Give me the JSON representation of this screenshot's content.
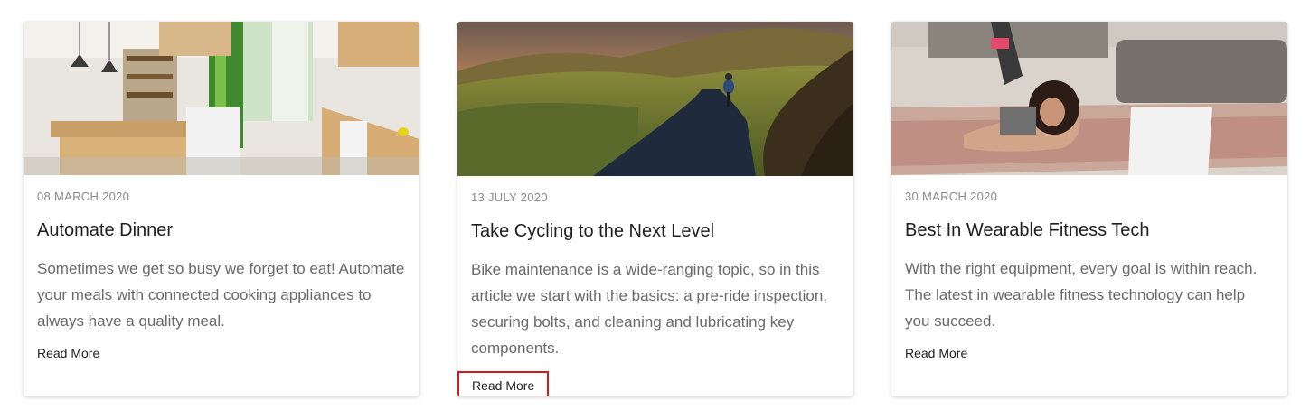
{
  "highlight_color": "#d41b1b",
  "cards": [
    {
      "image_desc": "modern-kitchen-image",
      "date": "08 MARCH 2020",
      "title": "Automate Dinner",
      "excerpt": "Sometimes we get so busy we forget to eat! Automate your meals with connected cooking appliances to always have a quality meal.",
      "read_more": "Read More"
    },
    {
      "image_desc": "cyclist-on-mountain-road-image",
      "date": "13 JULY 2020",
      "title": "Take Cycling to the Next Level",
      "excerpt": "Bike maintenance is a wide-ranging topic, so in this article we start with the basics: a pre-ride inspection, securing bolts, and cleaning and lubricating key components.",
      "read_more": "Read More"
    },
    {
      "image_desc": "woman-doing-pushups-image",
      "date": "30 MARCH 2020",
      "title": "Best In Wearable Fitness Tech",
      "excerpt": "With the right equipment, every goal is within reach. The latest in wearable fitness technology can help you succeed.",
      "read_more": "Read More"
    }
  ]
}
